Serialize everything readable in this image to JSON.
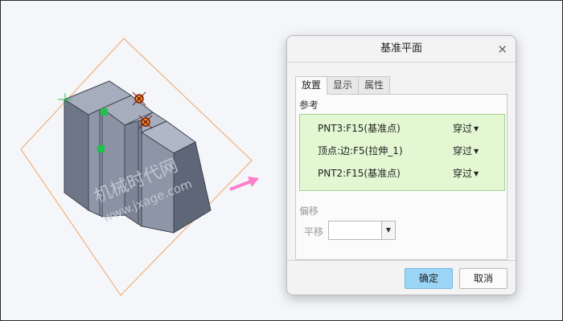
{
  "viewport": {
    "watermark_line1": "机械时代网",
    "watermark_line2": "www.jxage.com"
  },
  "dialog": {
    "title": "基准平面",
    "close_glyph": "×",
    "tabs": [
      {
        "label": "放置"
      },
      {
        "label": "显示"
      },
      {
        "label": "属性"
      }
    ],
    "references_label": "参考",
    "references": [
      {
        "name": "PNT3:F15(基准点)",
        "constraint": "穿过"
      },
      {
        "name": "顶点:边:F5(拉伸_1)",
        "constraint": "穿过"
      },
      {
        "name": "PNT2:F15(基准点)",
        "constraint": "穿过"
      }
    ],
    "offset_label": "偏移",
    "shift_label": "平移",
    "shift_value": "",
    "ok_label": "确定",
    "cancel_label": "取消"
  },
  "colors": {
    "plane_outline": "#f2a468",
    "model_fill": "#8d95a6",
    "reference_fill": "#e2f7d2",
    "ok_button": "#9bd5f5",
    "drag_arrow": "#ff7fc8",
    "selected_point": "#22c24a"
  }
}
